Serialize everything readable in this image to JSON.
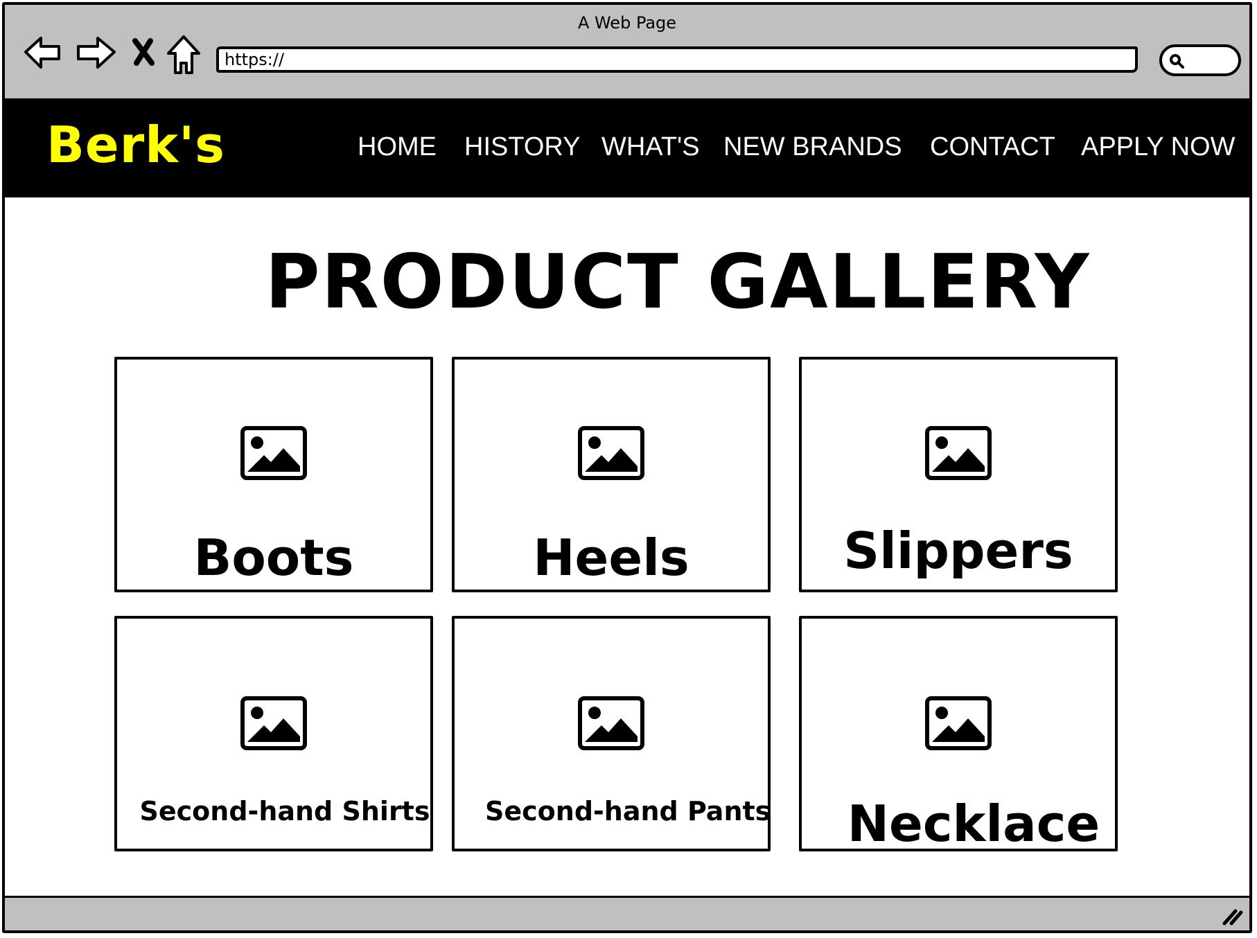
{
  "window": {
    "title": "A Web Page"
  },
  "browser": {
    "back_icon": "back-arrow-icon",
    "forward_icon": "forward-arrow-icon",
    "stop_icon": "close-icon",
    "home_icon": "home-icon",
    "url": "https://",
    "search_icon": "search-icon"
  },
  "site": {
    "logo": "Berk's",
    "colors": {
      "header_bg": "#000000",
      "logo": "#ffff00",
      "nav_text": "#ffffff"
    },
    "nav": [
      "HOME",
      "HISTORY",
      "WHAT'S",
      "NEW BRANDS",
      "CONTACT",
      "APPLY NOW"
    ]
  },
  "gallery": {
    "title": "PRODUCT GALLERY",
    "items": [
      {
        "label": "Boots",
        "icon": "image-icon"
      },
      {
        "label": "Heels",
        "icon": "image-icon"
      },
      {
        "label": "Slippers",
        "icon": "image-icon"
      },
      {
        "label": "Second-hand Shirts",
        "icon": "image-icon"
      },
      {
        "label": "Second-hand Pants",
        "icon": "image-icon"
      },
      {
        "label": "Necklace",
        "icon": "image-icon"
      }
    ]
  }
}
